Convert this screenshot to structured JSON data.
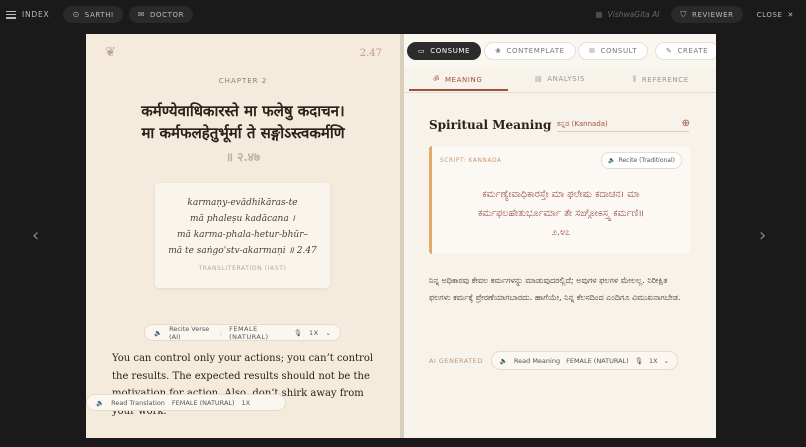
{
  "topbar": {
    "index_label": "INDEX",
    "sarthi_label": "SARTHI",
    "doctor_label": "DOCTOR",
    "brand": "VishwaGita AI",
    "reviewer_label": "REVIEWER",
    "close_label": "CLOSE"
  },
  "verse": {
    "number": "2.47",
    "chapter": "CHAPTER 2",
    "sanskrit_line1": "कर्मण्येवाधिकारस्ते मा फलेषु कदाचन।",
    "sanskrit_line2": "मा कर्मफलहेतुर्भूर्मा ते सङ्गोऽस्त्वकर्मणि",
    "sanskrit_ref": "॥ २.४७",
    "transliteration": [
      "karmaṇy-evādhikāras-te",
      "mā phaleṣu kadācana ।",
      "mā karma-phala-hetur-bhūr–",
      "mā te saṅgo'stv-akarmaṇi ॥ 2.47"
    ],
    "transliteration_caption": "TRANSLITERATION (IAST)",
    "recite_label": "Recite Verse (AI)",
    "recite_voice": "FEMALE (NATURAL)",
    "recite_speed": "1X",
    "translation": "You can control only your actions; you can’t control the results. The expected results should not be the motivation for action. Also, don’t shirk away from your work.",
    "read_label": "Read Translation",
    "read_voice": "FEMALE (NATURAL)",
    "read_speed": "1X"
  },
  "modes": [
    "CONSUME",
    "CONTEMPLATE",
    "CONSULT",
    "CREATE"
  ],
  "tabs": [
    "MEANING",
    "ANALYSIS",
    "REFERENCE"
  ],
  "meaning": {
    "title": "Spiritual Meaning",
    "language": "ಕನ್ನಡ (Kannada)",
    "script_label": "SCRIPT: KANNADA",
    "recite_traditional": "Recite (Traditional)",
    "kannada_lines": [
      "ಕರ್ಮಣ್ಯೇವಾಧಿಕಾರಸ್ತೇ ಮಾ ಫಲೇಷು ಕದಾಚನ। ಮಾ",
      "ಕರ್ಮಫಲಹೇತುರ್ಭೂರ್ಮಾ ತೇ ಸಙ್ಗೋಽಸ್ತ್ವ ಕರ್ಮಣಿ॥",
      "೨.೪೭"
    ],
    "body": "ನಿನ್ನ ಅಧಿಕಾರವು ಕೇವಲ ಕರ್ಮಗಳನ್ನು ಮಾಡುವುದರಲ್ಲಿದೆ; ಅವುಗಳ ಫಲಗಳ ಮೇಲಲ್ಲ. ನಿರೀಕ್ಷಿತ ಫಲಗಳು ಕರ್ಮಕ್ಕೆ ಪ್ರೇರಣೆಯಾಗಬಾರದು. ಹಾಗೆಯೇ, ನಿನ್ನ ಕೆಲಸದಿಂದ ಎಂದಿಗೂ ವಿಮುಖನಾಗಬೇಡ.",
    "ai_label": "AI GENERATED",
    "read_meaning": "Read Meaning",
    "read_voice": "FEMALE (NATURAL)",
    "read_speed": "1X"
  }
}
